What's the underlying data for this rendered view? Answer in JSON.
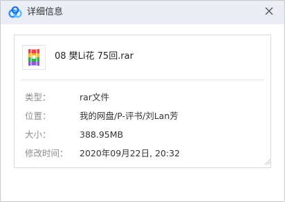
{
  "window": {
    "title": "详细信息"
  },
  "file": {
    "name": "08 樊Li花 75回.rar",
    "icon": "rar-archive-icon"
  },
  "details": [
    {
      "label": "类型：",
      "value": "rar文件"
    },
    {
      "label": "位置：",
      "value": "我的网盘/P-评书/刘Lan芳"
    },
    {
      "label": "大小：",
      "value": "388.95MB"
    },
    {
      "label": "修改时间：",
      "value": "2020年09月22日, 20:32"
    }
  ],
  "colors": {
    "titlebar": "#eaeef4",
    "label": "#8d8d8d",
    "value": "#333333",
    "border": "#d9d9d9"
  }
}
